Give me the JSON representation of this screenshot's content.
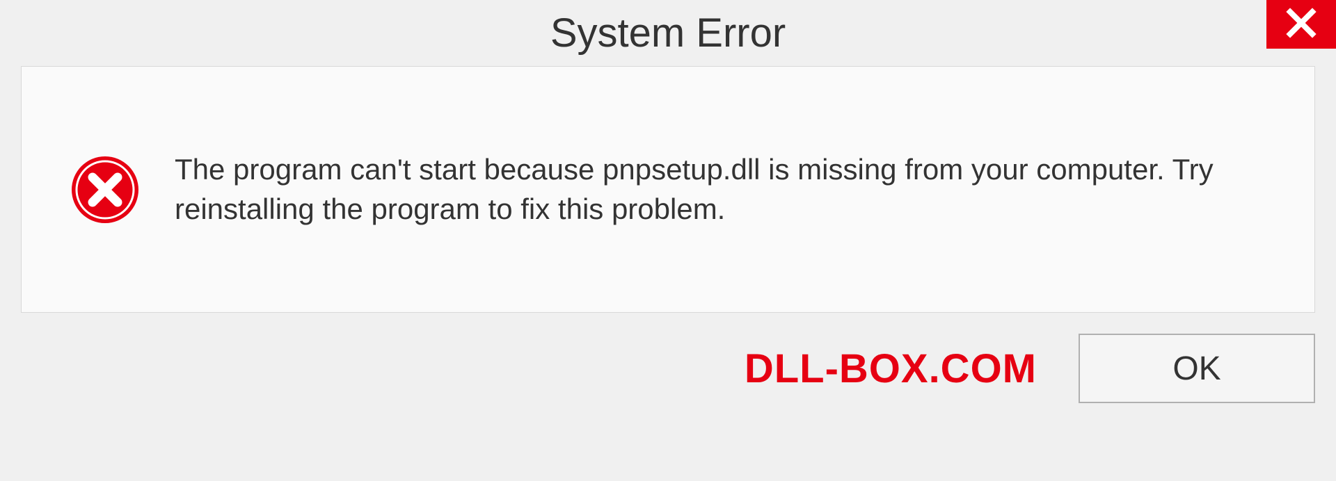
{
  "dialog": {
    "title": "System Error",
    "message": "The program can't start because pnpsetup.dll is missing from your computer. Try reinstalling the program to fix this problem.",
    "ok_label": "OK"
  },
  "watermark": "DLL-BOX.COM",
  "colors": {
    "accent_red": "#e60012",
    "panel_bg": "#fafafa",
    "window_bg": "#f0f0f0"
  }
}
